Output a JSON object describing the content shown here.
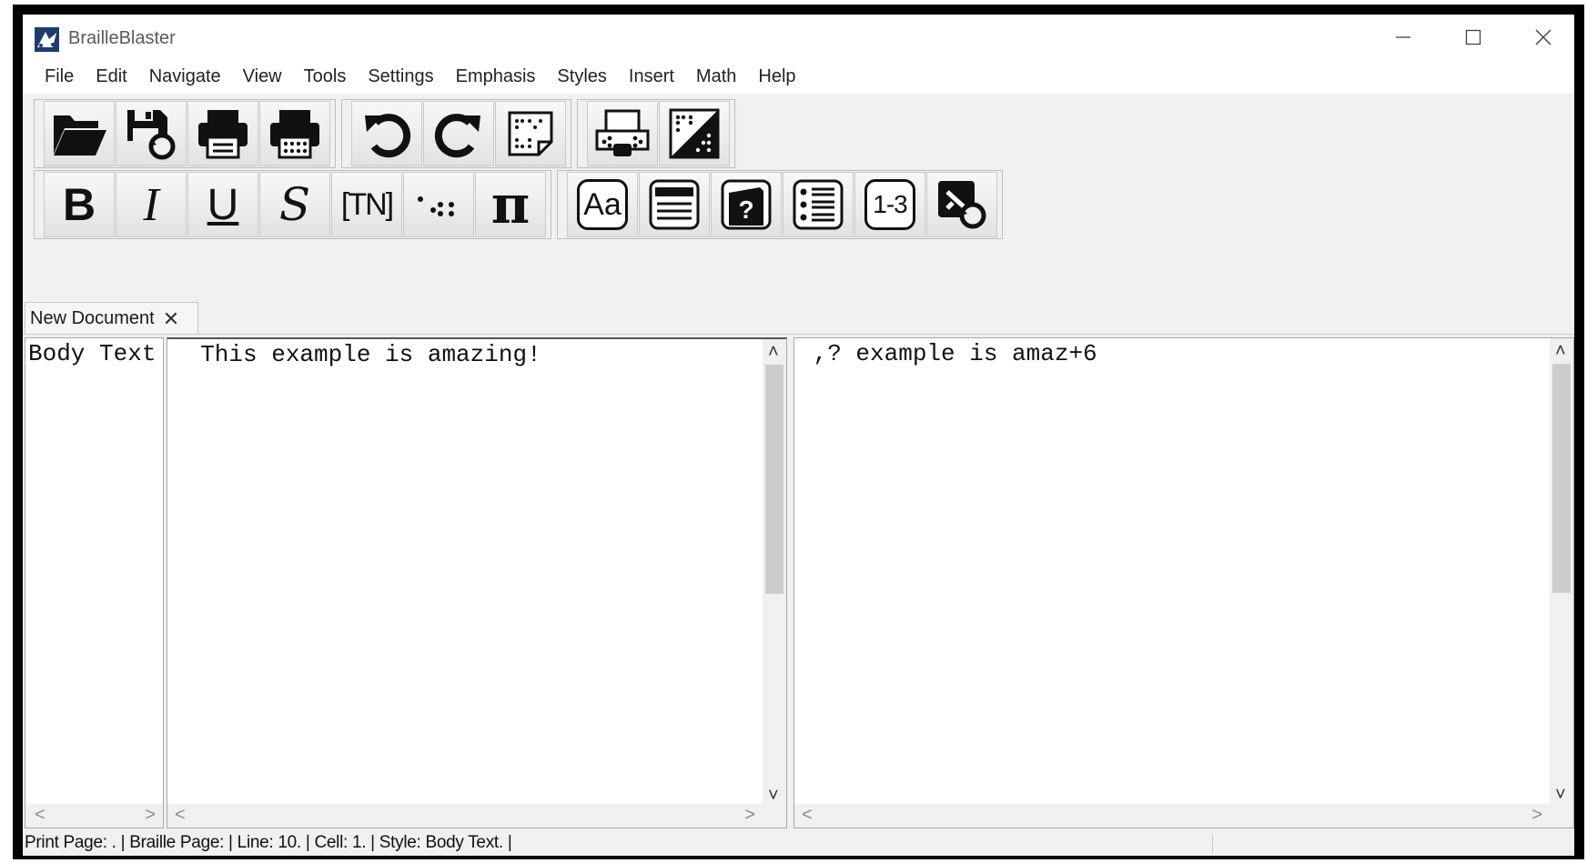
{
  "window": {
    "title": "BrailleBlaster",
    "minimize_label": "Minimize",
    "maximize_label": "Maximize",
    "close_label": "Close"
  },
  "menu": [
    "File",
    "Edit",
    "Navigate",
    "View",
    "Tools",
    "Settings",
    "Emphasis",
    "Styles",
    "Insert",
    "Math",
    "Help"
  ],
  "toolbar1": {
    "groups": [
      [
        "open-folder-icon",
        "save-as-icon",
        "print-icon",
        "braille-print-icon"
      ],
      [
        "undo-icon",
        "redo-icon",
        "braille-page-icon"
      ],
      [
        "embosser-icon",
        "braille-translate-icon"
      ]
    ]
  },
  "toolbar2": {
    "emphasis": {
      "bold": "B",
      "italic": "I",
      "underline": "U",
      "script": "S",
      "transcriber_note": "[TN]",
      "braille_dots": "·.::",
      "math": "π"
    },
    "styles": {
      "text_case": "Aa",
      "list": "1-3",
      "help": "?"
    }
  },
  "tab": {
    "label": "New Document",
    "close": "✕"
  },
  "style_pane": {
    "text": "Body Text"
  },
  "print_pane": {
    "text": "  This example is amazing!"
  },
  "braille_pane": {
    "text": " ,? example is amaz+6"
  },
  "status": {
    "text": "Print Page: . | Braille Page:  | Line: 10. | Cell: 1. | Style: Body Text. |"
  },
  "scroll_arrows": {
    "up": "˄",
    "down": "˅",
    "left": "<",
    "right": ">"
  }
}
